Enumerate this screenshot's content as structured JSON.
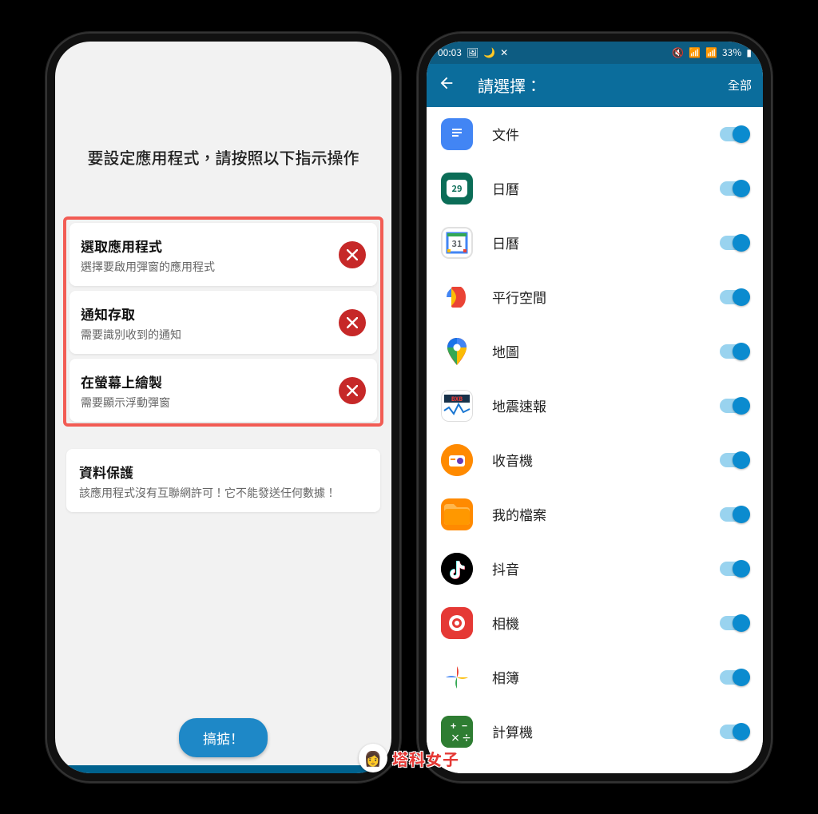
{
  "phone1": {
    "heading": "要設定應用程式，請按照以下指示操作",
    "steps": [
      {
        "title": "選取應用程式",
        "sub": "選擇要啟用彈窗的應用程式"
      },
      {
        "title": "通知存取",
        "sub": "需要識別收到的通知"
      },
      {
        "title": "在螢幕上繪製",
        "sub": "需要顯示浮動彈窗"
      }
    ],
    "info": {
      "title": "資料保護",
      "sub": "該應用程式沒有互聯網許可！它不能發送任何數據！"
    },
    "done_label": "搞掂！"
  },
  "phone2": {
    "status": {
      "time": "00:03",
      "battery": "33%"
    },
    "appbar": {
      "title": "請選擇：",
      "action": "全部"
    },
    "apps": [
      {
        "label": "文件",
        "icon": "docs-icon"
      },
      {
        "label": "日曆",
        "icon": "calendar-29-icon",
        "badge": "29"
      },
      {
        "label": "日曆",
        "icon": "google-calendar-icon",
        "badge": "31"
      },
      {
        "label": "平行空間",
        "icon": "parallel-space-icon"
      },
      {
        "label": "地圖",
        "icon": "maps-icon"
      },
      {
        "label": "地震速報",
        "icon": "quake-icon"
      },
      {
        "label": "收音機",
        "icon": "radio-icon"
      },
      {
        "label": "我的檔案",
        "icon": "files-icon"
      },
      {
        "label": "抖音",
        "icon": "tiktok-icon"
      },
      {
        "label": "相機",
        "icon": "camera-icon"
      },
      {
        "label": "相簿",
        "icon": "photos-icon"
      },
      {
        "label": "計算機",
        "icon": "calculator-icon"
      }
    ]
  },
  "watermark": "塔科女子"
}
